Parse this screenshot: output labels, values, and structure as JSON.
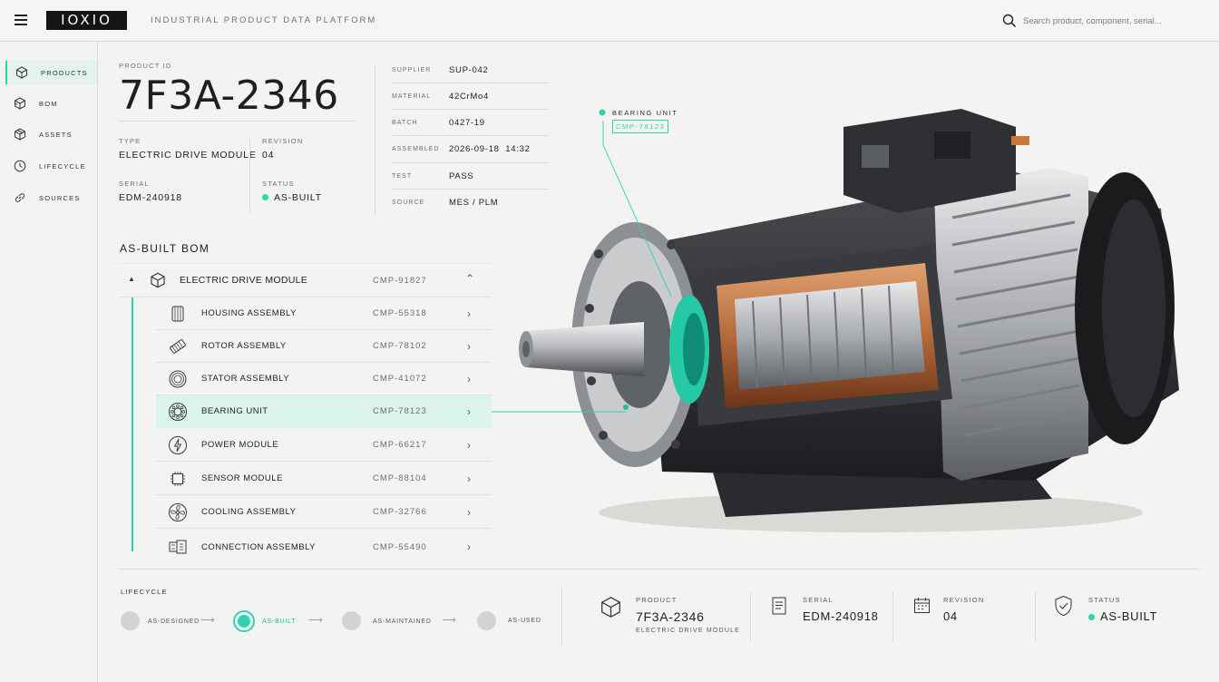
{
  "header": {
    "logo": "IOXIO",
    "platform": "INDUSTRIAL PRODUCT DATA PLATFORM",
    "search_placeholder": "Search product, component, serial..."
  },
  "sidebar": {
    "items": [
      {
        "label": "PRODUCTS",
        "icon": "cube-icon",
        "active": true
      },
      {
        "label": "BOM",
        "icon": "cube-stack-icon",
        "active": false
      },
      {
        "label": "ASSETS",
        "icon": "box-icon",
        "active": false
      },
      {
        "label": "LIFECYCLE",
        "icon": "clock-icon",
        "active": false
      },
      {
        "label": "SOURCES",
        "icon": "link-icon",
        "active": false
      }
    ]
  },
  "product": {
    "id_label": "PRODUCT ID",
    "id": "7F3A-2346",
    "type_label": "TYPE",
    "type": "ELECTRIC DRIVE MODULE",
    "revision_label": "REVISION",
    "revision": "04",
    "serial_label": "SERIAL",
    "serial": "EDM-240918",
    "status_label": "STATUS",
    "status": "AS-BUILT"
  },
  "details": [
    {
      "label": "SUPPLIER",
      "value": "SUP-042"
    },
    {
      "label": "MATERIAL",
      "value": "42CrMo4"
    },
    {
      "label": "BATCH",
      "value": "0427-19"
    },
    {
      "label": "ASSEMBLED",
      "value": "2026-09-18  14:32"
    },
    {
      "label": "TEST",
      "value": "PASS"
    },
    {
      "label": "SOURCE",
      "value": "MES / PLM"
    }
  ],
  "bom": {
    "title": "AS-BUILT BOM",
    "root": {
      "name": "ELECTRIC DRIVE MODULE",
      "code": "CMP-91827"
    },
    "items": [
      {
        "name": "HOUSING ASSEMBLY",
        "code": "CMP-55318",
        "icon": "housing-icon"
      },
      {
        "name": "ROTOR ASSEMBLY",
        "code": "CMP-78102",
        "icon": "rotor-icon"
      },
      {
        "name": "STATOR ASSEMBLY",
        "code": "CMP-41072",
        "icon": "stator-icon"
      },
      {
        "name": "BEARING UNIT",
        "code": "CMP-78123",
        "icon": "bearing-icon",
        "selected": true
      },
      {
        "name": "POWER MODULE",
        "code": "CMP-66217",
        "icon": "power-icon"
      },
      {
        "name": "SENSOR MODULE",
        "code": "CMP-88104",
        "icon": "sensor-icon"
      },
      {
        "name": "COOLING ASSEMBLY",
        "code": "CMP-32766",
        "icon": "fan-icon"
      },
      {
        "name": "CONNECTION ASSEMBLY",
        "code": "CMP-55490",
        "icon": "connector-icon"
      }
    ]
  },
  "callout": {
    "title": "BEARING UNIT",
    "code": "CMP-78123"
  },
  "lifecycle": {
    "title": "LIFECYCLE",
    "stages": [
      "AS-DESIGNED",
      "AS-BUILT",
      "AS-MAINTAINED",
      "AS-USED"
    ],
    "current": "AS-BUILT"
  },
  "summary": {
    "product_label": "PRODUCT",
    "product": "7F3A-2346",
    "product_sub": "ELECTRIC DRIVE MODULE",
    "serial_label": "SERIAL",
    "serial": "EDM-240918",
    "revision_label": "REVISION",
    "revision": "04",
    "status_label": "STATUS",
    "status": "AS-BUILT"
  },
  "colors": {
    "accent": "#2ed3b0",
    "highlight": "#daf4ec",
    "text": "#1d1f22"
  }
}
